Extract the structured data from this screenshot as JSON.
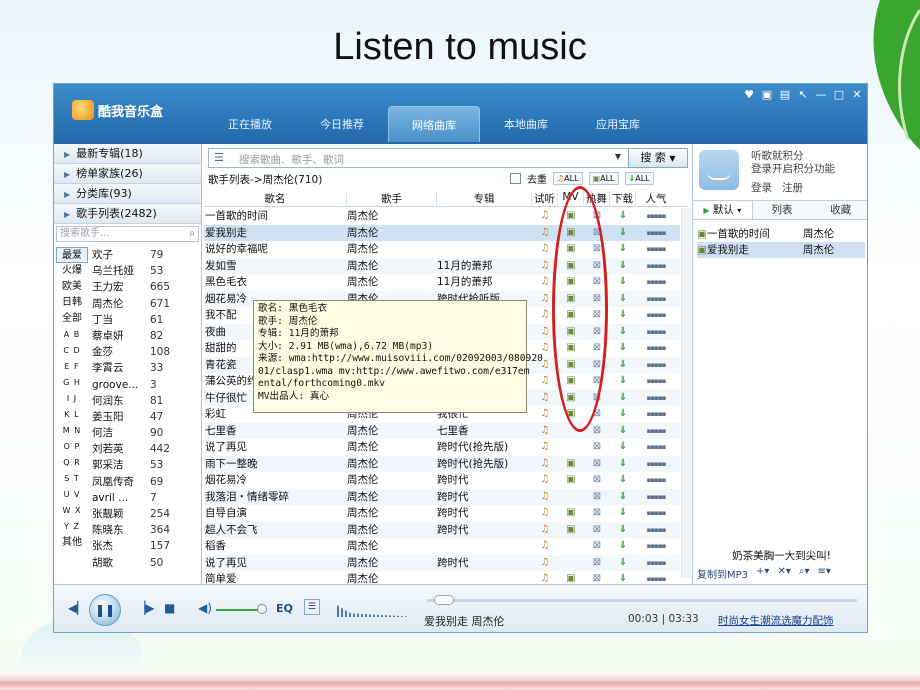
{
  "slide": {
    "title": "Listen to music"
  },
  "app": {
    "name": "酷我音乐盒",
    "window_controls": [
      "♥",
      "▣",
      "▤",
      "↖",
      "—",
      "□",
      "✕"
    ],
    "tabs": [
      "正在播放",
      "今日推荐",
      "网络曲库",
      "本地曲库",
      "应用宝库"
    ],
    "active_tab": "网络曲库"
  },
  "left": {
    "categories": [
      {
        "label": "最新专辑",
        "count": "(18)"
      },
      {
        "label": "榜单家族",
        "count": "(26)"
      },
      {
        "label": "分类库",
        "count": "(93)"
      },
      {
        "label": "歌手列表",
        "count": "(2482)"
      }
    ],
    "search_placeholder": "搜索歌手...",
    "letters": [
      "最爱",
      "火爆",
      "欧美",
      "日韩",
      "全部",
      "A B",
      "C D",
      "E F",
      "G H",
      "I J",
      "K L",
      "M N",
      "O P",
      "Q R",
      "S T",
      "U V",
      "W X",
      "Y Z",
      "其他"
    ],
    "singers": [
      {
        "name": "欢子",
        "count": "79"
      },
      {
        "name": "乌兰托娅",
        "count": "53"
      },
      {
        "name": "王力宏",
        "count": "665"
      },
      {
        "name": "周杰伦",
        "count": "671"
      },
      {
        "name": "丁当",
        "count": "61"
      },
      {
        "name": "蔡卓妍",
        "count": "82"
      },
      {
        "name": "金莎",
        "count": "108"
      },
      {
        "name": "李霄云",
        "count": "33"
      },
      {
        "name": "groove...",
        "count": "3"
      },
      {
        "name": "何润东",
        "count": "81"
      },
      {
        "name": "姜玉阳",
        "count": "47"
      },
      {
        "name": "何洁",
        "count": "90"
      },
      {
        "name": "刘若英",
        "count": "442"
      },
      {
        "name": "郭采洁",
        "count": "53"
      },
      {
        "name": "凤凰传奇",
        "count": "69"
      },
      {
        "name": "avril ...",
        "count": "7"
      },
      {
        "name": "张靓颖",
        "count": "254"
      },
      {
        "name": "陈晓东",
        "count": "364"
      },
      {
        "name": "张杰",
        "count": "157"
      },
      {
        "name": "胡歌",
        "count": "50"
      }
    ]
  },
  "main": {
    "search_placeholder": "搜索歌曲、歌手、歌词",
    "search_button": "搜 索",
    "breadcrumb": "歌手列表->周杰伦(710)",
    "dedupe_label": "去重",
    "all_label": "ALL",
    "columns": [
      "歌名",
      "歌手",
      "专辑",
      "试听",
      "MV",
      "热舞",
      "下载",
      "人气"
    ],
    "rows": [
      {
        "name": "一首歌的时间",
        "artist": "周杰伦",
        "album": "",
        "mv": true
      },
      {
        "name": "爱我别走",
        "artist": "周杰伦",
        "album": "",
        "mv": true,
        "hl": true
      },
      {
        "name": "说好的幸福呢",
        "artist": "周杰伦",
        "album": "",
        "mv": true
      },
      {
        "name": "发如雪",
        "artist": "周杰伦",
        "album": "11月的萧邦",
        "mv": true
      },
      {
        "name": "黑色毛衣",
        "artist": "周杰伦",
        "album": "11月的萧邦",
        "mv": true
      },
      {
        "name": "烟花易冷",
        "artist": "周杰伦",
        "album": "跨时代抢听版",
        "mv": true
      },
      {
        "name": "我不配",
        "artist": "周杰伦",
        "album": "",
        "mv": true
      },
      {
        "name": "夜曲",
        "artist": "周杰伦",
        "album": "",
        "mv": true
      },
      {
        "name": "甜甜的",
        "artist": "周杰伦",
        "album": "",
        "mv": true
      },
      {
        "name": "青花瓷",
        "artist": "周杰伦",
        "album": "",
        "mv": true
      },
      {
        "name": "蒲公英的约定",
        "artist": "周杰伦",
        "album": "",
        "mv": true
      },
      {
        "name": "牛仔很忙",
        "artist": "周杰伦",
        "album": "",
        "mv": true
      },
      {
        "name": "彩虹",
        "artist": "周杰伦",
        "album": "我很忙",
        "mv": true
      },
      {
        "name": "七里香",
        "artist": "周杰伦",
        "album": "七里香",
        "mv": false
      },
      {
        "name": "说了再见",
        "artist": "周杰伦",
        "album": "跨时代(抢先版)",
        "mv": false
      },
      {
        "name": "雨下一整晚",
        "artist": "周杰伦",
        "album": "跨时代(抢先版)",
        "mv": true
      },
      {
        "name": "烟花易冷",
        "artist": "周杰伦",
        "album": "跨时代",
        "mv": true
      },
      {
        "name": "我落泪・情绪零碎",
        "artist": "周杰伦",
        "album": "跨时代",
        "mv": false
      },
      {
        "name": "自导自演",
        "artist": "周杰伦",
        "album": "跨时代",
        "mv": true
      },
      {
        "name": "超人不会飞",
        "artist": "周杰伦",
        "album": "跨时代",
        "mv": true
      },
      {
        "name": "稻香",
        "artist": "周杰伦",
        "album": "",
        "mv": false
      },
      {
        "name": "说了再见",
        "artist": "周杰伦",
        "album": "跨时代",
        "mv": false
      },
      {
        "name": "简单爱",
        "artist": "周杰伦",
        "album": "",
        "mv": true
      }
    ],
    "tooltip": [
      "歌名: 黑色毛衣",
      "歌手: 周杰伦",
      "专辑: 11月的萧邦",
      "大小: 2.91 MB(wma),6.72 MB(mp3)",
      "来源: wma:http://www.muisoviii.com/02092003/080920",
      "01/clasp1.wma   mv:http://www.awefitwo.com/e317em",
      "ental/forthcoming0.mkv",
      "MV出品人: 真心"
    ]
  },
  "right": {
    "points_line1": "听歌就积分",
    "points_line2": "登录开启积分功能",
    "login": "登录",
    "register": "注册",
    "tabs": [
      "默认",
      "列表",
      "收藏"
    ],
    "playlist": [
      {
        "title": "一首歌的时间",
        "artist": "周杰伦"
      },
      {
        "title": "爱我别走",
        "artist": "周杰伦",
        "hl": true
      }
    ],
    "promo": "奶茶美胸一大到尖叫!",
    "copy_to_mp3": "复制到MP3"
  },
  "player": {
    "eq": "EQ",
    "now_playing": "爱我别走 周杰伦",
    "time": "00:03 | 03:33",
    "promo": "时尚女生潮流选魔力配饰",
    "progress_fraction": 0.014
  },
  "colors": {
    "header": "#2d78ba",
    "highlight_row": "#cfe2f3",
    "annotation_circle": "#d42020",
    "tooltip_bg": "#fffde1"
  }
}
